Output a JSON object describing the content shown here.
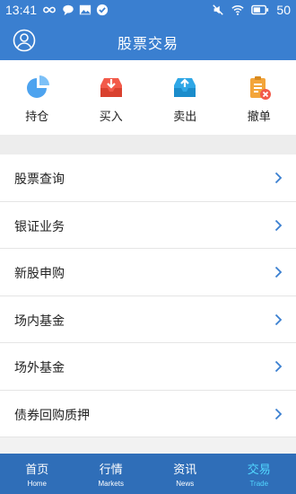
{
  "status_bar": {
    "time": "13:41",
    "battery": "50",
    "icons": [
      "infinity-icon",
      "chat-icon",
      "image-icon",
      "check-icon",
      "mute-icon",
      "wifi-icon",
      "battery-icon"
    ]
  },
  "header": {
    "title": "股票交易",
    "user_icon": "user-icon"
  },
  "quick_actions": [
    {
      "label": "持仓",
      "icon": "pie-chart-icon",
      "color": "#4da3ef"
    },
    {
      "label": "买入",
      "icon": "inbox-download-icon",
      "color": "#f25a4a"
    },
    {
      "label": "卖出",
      "icon": "inbox-upload-icon",
      "color": "#2fa7e6"
    },
    {
      "label": "撤单",
      "icon": "cancel-order-icon",
      "color": "#f3a53a"
    }
  ],
  "menu_items": [
    {
      "label": "股票查询"
    },
    {
      "label": "银证业务"
    },
    {
      "label": "新股申购"
    },
    {
      "label": "场内基金"
    },
    {
      "label": "场外基金"
    },
    {
      "label": "债券回购质押"
    }
  ],
  "tabs": [
    {
      "label": "首页",
      "sub": "Home",
      "active": false
    },
    {
      "label": "行情",
      "sub": "Markets",
      "active": false
    },
    {
      "label": "资讯",
      "sub": "News",
      "active": false
    },
    {
      "label": "交易",
      "sub": "Trade",
      "active": true
    }
  ],
  "colors": {
    "header": "#3a7fd0",
    "tabbar": "#2f6eb8",
    "tab_active": "#52d6ff",
    "chevron": "#3a7fd0"
  }
}
